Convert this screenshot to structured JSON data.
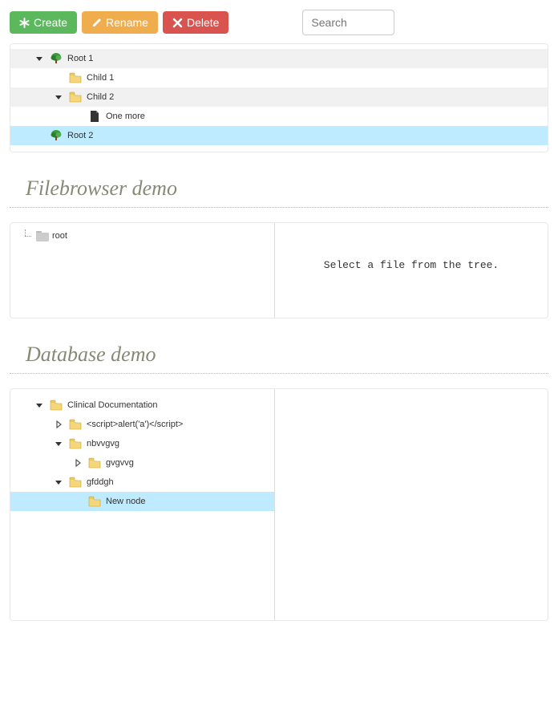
{
  "toolbar": {
    "create_label": "Create",
    "rename_label": "Rename",
    "delete_label": "Delete",
    "search_placeholder": "Search"
  },
  "tree1": {
    "root1": "Root 1",
    "child1": "Child 1",
    "child2": "Child 2",
    "one_more": "One more",
    "root2": "Root 2"
  },
  "sections": {
    "filebrowser_title": "Filebrowser demo",
    "database_title": "Database demo"
  },
  "filebrowser": {
    "root_label": "root",
    "placeholder_text": "Select a file from the tree."
  },
  "db_tree": {
    "n0": "Clinical Documentation",
    "n1": "<script>alert('a')</script>",
    "n2": "nbvvgvg",
    "n3": "gvgvvg",
    "n4": "gfddgh",
    "n5": "New node"
  }
}
